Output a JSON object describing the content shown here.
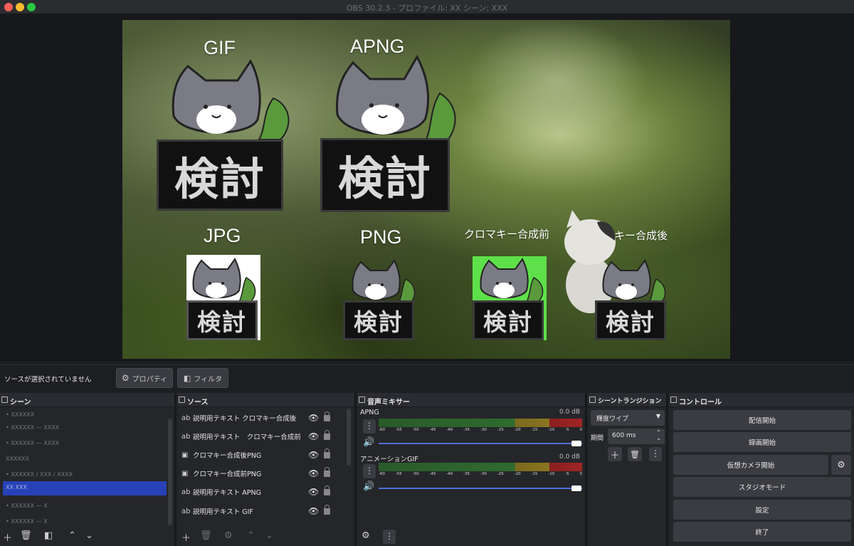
{
  "window": {
    "title": "OBS 30.2.3 - プロファイル: XX シーン: XXX"
  },
  "preview": {
    "labels": {
      "gif": "GIF",
      "apng": "APNG",
      "jpg": "JPG",
      "png": "PNG",
      "chroma_before": "クロマキー合成前",
      "chroma_after": "クロマキー合成後"
    },
    "sign_text": "検討"
  },
  "status": {
    "no_source": "ソースが選択されていません",
    "properties": "プロパティ",
    "filters": "フィルタ"
  },
  "scenes": {
    "title": "シーン",
    "items": [
      "• XXXXXX",
      "• XXXXXX — XXXX",
      "• XXXXXX — XXXX",
      "XXXXXX",
      "• XXXXXX / XXX / XXXX",
      "XX XXX",
      "• XXXXXX — X",
      "• XXXXXX — X"
    ],
    "selected_index": 5
  },
  "sources": {
    "title": "ソース",
    "items": [
      {
        "icon": "text",
        "name": "説明用テキスト クロマキー合成後"
      },
      {
        "icon": "text",
        "name": "説明用テキスト　クロマキー合成前"
      },
      {
        "icon": "image",
        "name": "クロマキー合成後PNG"
      },
      {
        "icon": "image",
        "name": "クロマキー合成前PNG"
      },
      {
        "icon": "text",
        "name": "説明用テキスト APNG"
      },
      {
        "icon": "text",
        "name": "説明用テキスト GIF"
      }
    ]
  },
  "mixer": {
    "title": "音声ミキサー",
    "channels": [
      {
        "name": "APNG",
        "level": "0.0 dB",
        "volume": 1.0
      },
      {
        "name": "アニメーションGIF",
        "level": "0.0 dB",
        "volume": 1.0
      }
    ],
    "ticks": [
      "-60",
      "-55",
      "-50",
      "-45",
      "-40",
      "-35",
      "-30",
      "-25",
      "-20",
      "-15",
      "-10",
      "-5",
      "0"
    ]
  },
  "transitions": {
    "title": "シーントランジション",
    "type": "輝度ワイプ",
    "duration_label": "期間",
    "duration": "600 ms"
  },
  "controls": {
    "title": "コントロール",
    "start_stream": "配信開始",
    "start_record": "録画開始",
    "virtual_cam": "仮想カメラ開始",
    "studio_mode": "スタジオモード",
    "settings": "設定",
    "exit": "終了"
  }
}
